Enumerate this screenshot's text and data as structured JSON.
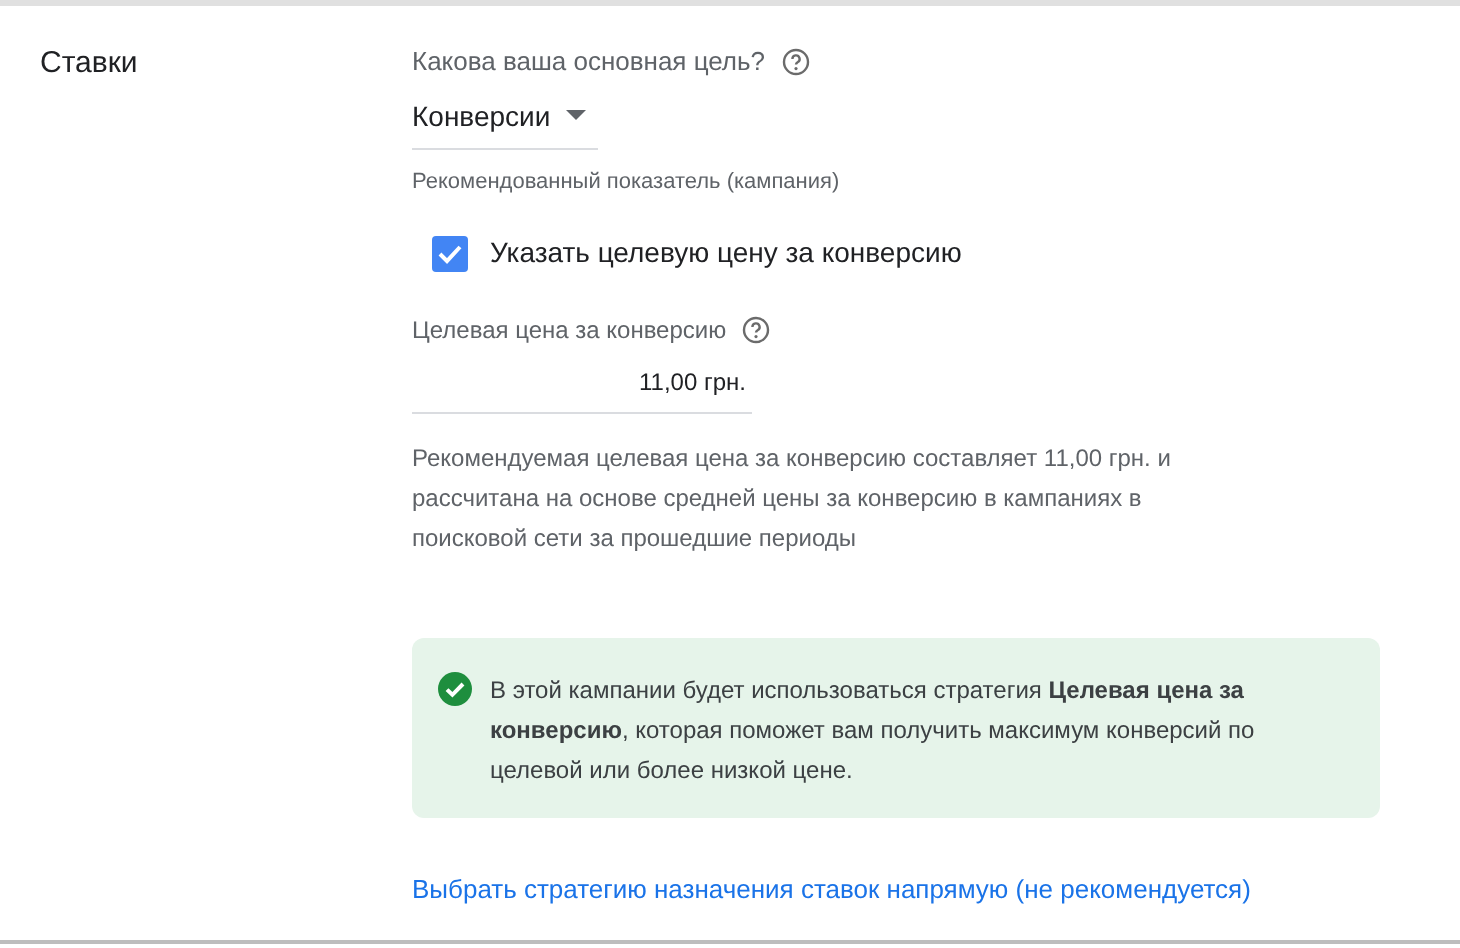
{
  "section_title": "Ставки",
  "goal": {
    "label": "Какова ваша основная цель?",
    "value": "Конверсии",
    "hint": "Рекомендованный показатель (кампания)"
  },
  "target_checkbox": {
    "label": "Указать целевую цену за конверсию",
    "checked": true
  },
  "target_price": {
    "label": "Целевая цена за конверсию",
    "value": "11,00 грн."
  },
  "recommendation": "Рекомендуемая целевая цена за конверсию составляет 11,00 грн. и рассчитана на основе средней цены за конверсию в кампаниях в поисковой сети за прошедшие периоды",
  "info": "В этой кампании будет использоваться стратегия **Целевая цена за конверсию**, которая поможет вам получить максимум конверсий по целевой или более низкой цене.",
  "link": "Выбрать стратегию назначения ставок напрямую (не рекомендуется)"
}
